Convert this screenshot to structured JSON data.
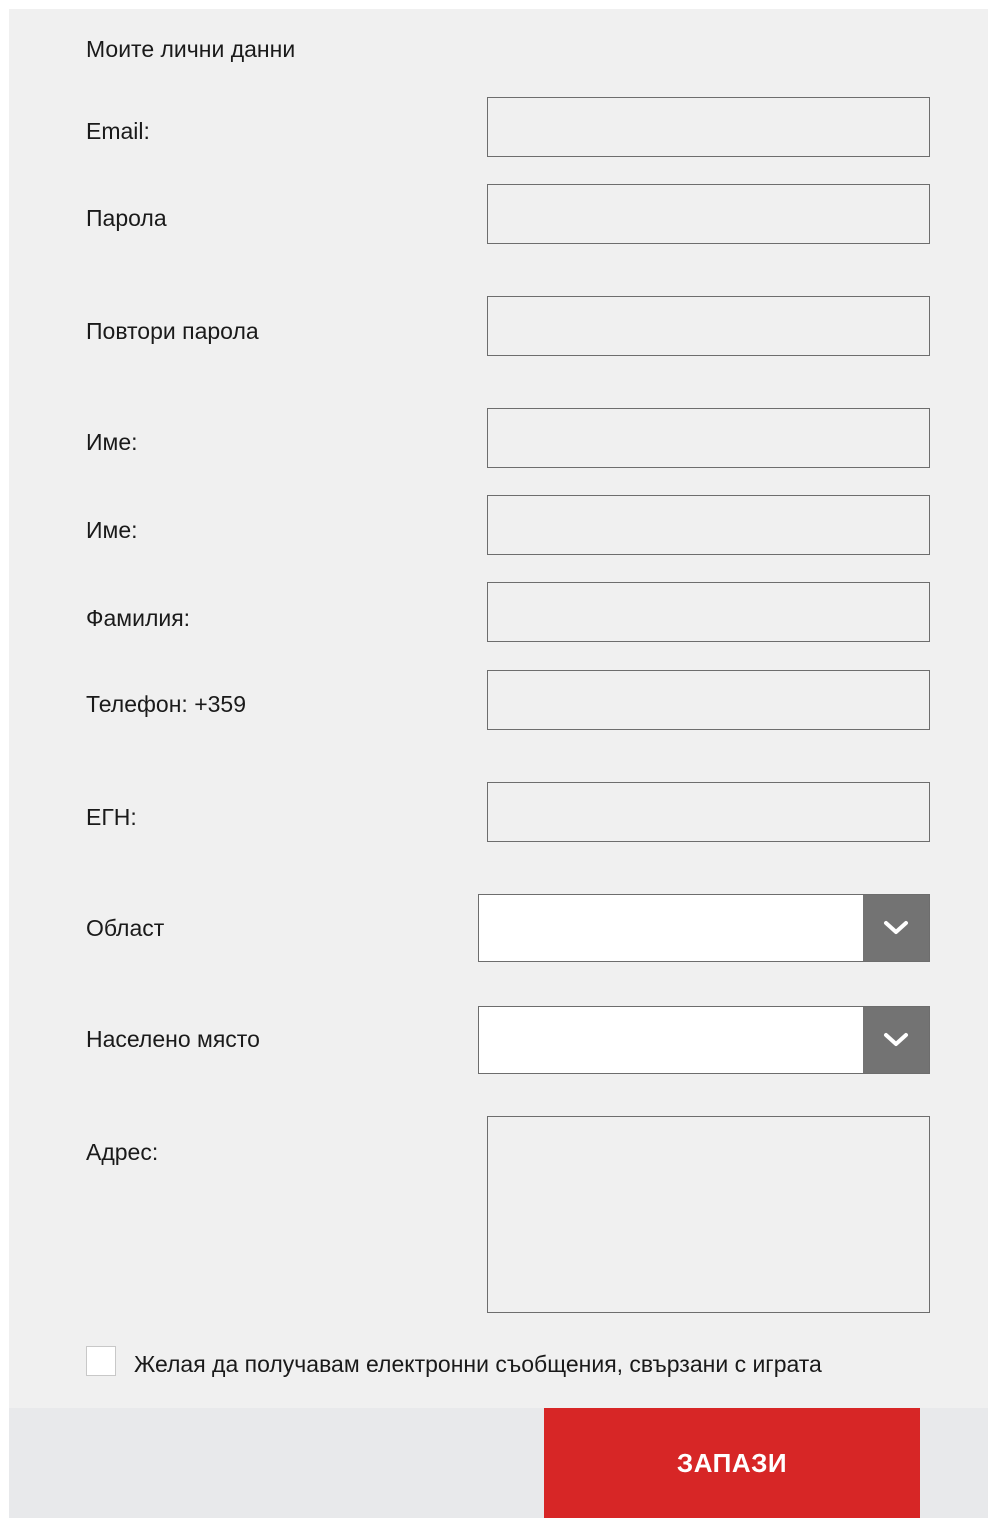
{
  "form": {
    "title": "Моите лични данни",
    "fields": {
      "email": {
        "label": "Email:",
        "value": ""
      },
      "password": {
        "label": "Парола",
        "value": ""
      },
      "repeat_password": {
        "label": "Повтори парола",
        "value": ""
      },
      "name": {
        "label": "Име:",
        "value": ""
      },
      "name2": {
        "label": "Име:",
        "value": ""
      },
      "surname": {
        "label": "Фамилия:",
        "value": ""
      },
      "phone": {
        "label": "Телефон: +359",
        "value": ""
      },
      "egn": {
        "label": "ЕГН:",
        "value": ""
      },
      "region": {
        "label": "Област",
        "selected": ""
      },
      "settlement": {
        "label": "Населено място",
        "selected": ""
      },
      "address": {
        "label": "Адрес:",
        "value": ""
      }
    },
    "newsletter": {
      "label": "Желая да получавам електронни съобщения, свързани с играта",
      "checked": false
    },
    "save_label": "ЗАПАЗИ"
  },
  "colors": {
    "panel_background": "#f0f0f0",
    "footer_background": "#e8e9eb",
    "accent": "#d72626",
    "dropdown_button": "#737373"
  },
  "icons": {
    "dropdown": "chevron-down-icon"
  }
}
